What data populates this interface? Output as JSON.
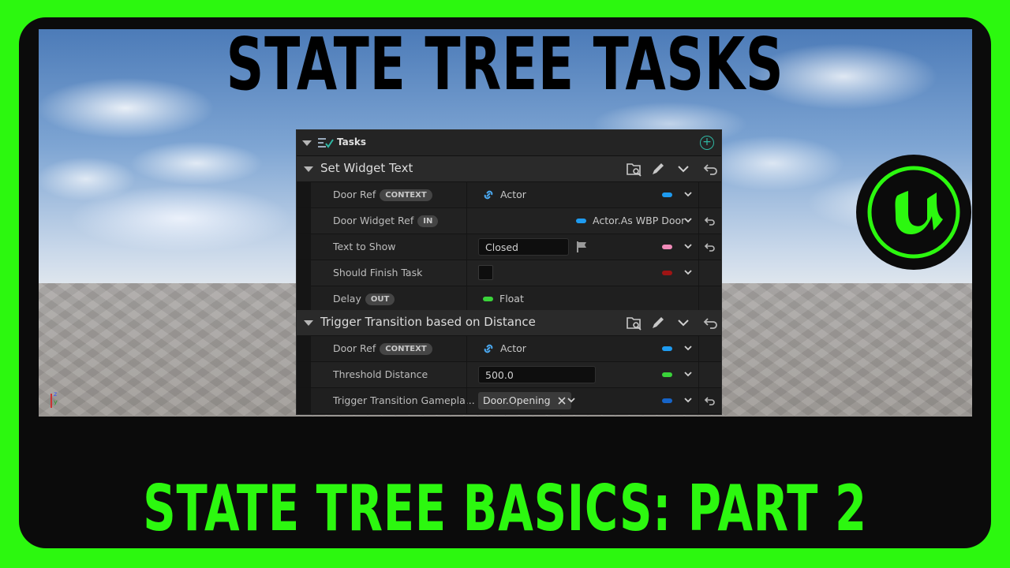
{
  "thumbnail": {
    "title_top": "STATE TREE TASKS",
    "title_bottom": "STATE TREE BASICS: PART 2"
  },
  "panel": {
    "header_title": "Tasks",
    "tasks": [
      {
        "title": "Set Widget Text",
        "properties": [
          {
            "label": "Door Ref",
            "badge": "CONTEXT",
            "value": "Actor",
            "pill_color": "#1e9bf0"
          },
          {
            "label": "Door Widget Ref",
            "badge": "IN",
            "value": "Actor.As WBP Door",
            "pill_color": "#1e9bf0"
          },
          {
            "label": "Text to Show",
            "value": "Closed",
            "pill_color": "#f08ab8"
          },
          {
            "label": "Should Finish Task",
            "pill_color": "#9e1414"
          },
          {
            "label": "Delay",
            "badge": "OUT",
            "value": "Float",
            "pill_color": "#3ad33a"
          }
        ]
      },
      {
        "title": "Trigger Transition based on Distance",
        "properties": [
          {
            "label": "Door Ref",
            "badge": "CONTEXT",
            "value": "Actor",
            "pill_color": "#1e9bf0"
          },
          {
            "label": "Threshold Distance",
            "value": "500.0",
            "pill_color": "#3ad33a"
          },
          {
            "label": "Trigger Transition Gamepla...",
            "value": "Door.Opening",
            "pill_color": "#1664c8"
          }
        ]
      }
    ]
  },
  "icons": {
    "collapse": "triangle-down-icon",
    "tasks": "checklist-icon",
    "add": "plus-circle-icon",
    "browse": "folder-search-icon",
    "edit": "pencil-icon",
    "expand": "chevron-down-icon",
    "revert": "revert-arrow-icon",
    "link": "link-icon",
    "flag": "flag-icon",
    "clear": "x-icon",
    "engine_logo": "unreal-logo"
  },
  "colors": {
    "background_green": "#2cf80f",
    "frame": "#0b0b0b",
    "accent_teal": "#2fb7a3"
  }
}
